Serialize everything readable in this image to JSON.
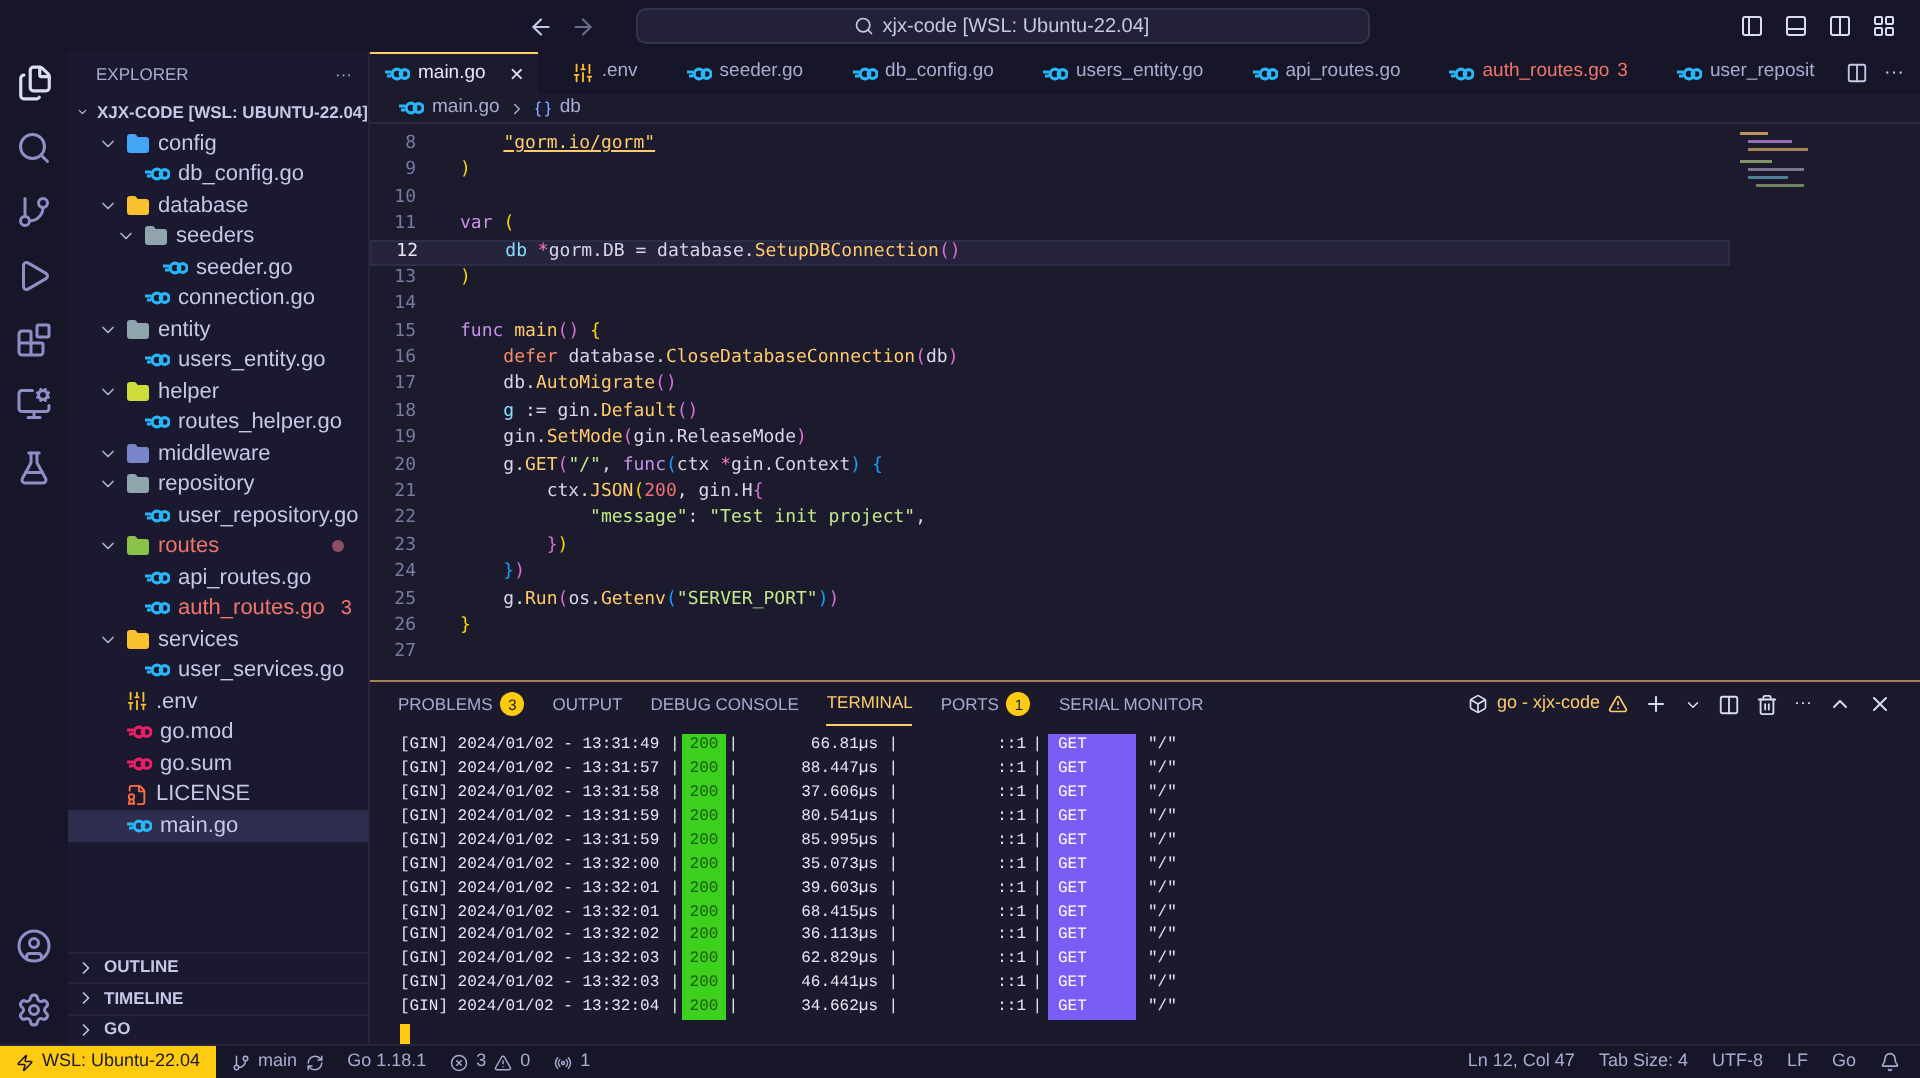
{
  "title_bar": {
    "search": "xjx-code [WSL: Ubuntu-22.04]"
  },
  "sidebar": {
    "title": "EXPLORER",
    "more": "···",
    "root": {
      "name": "XJX-CODE [WSL: UBUNTU-22.04]",
      "expanded": true
    },
    "tree": [
      {
        "name": "config",
        "kind": "folder",
        "color": "#42a5f5",
        "expanded": true,
        "selected": false,
        "error": false,
        "children": [
          {
            "name": "db_config.go",
            "kind": "go",
            "selected": false,
            "error": false
          }
        ]
      },
      {
        "name": "database",
        "kind": "folder",
        "color": "#fbc02d",
        "expanded": true,
        "selected": false,
        "error": false,
        "children": [
          {
            "name": "seeders",
            "kind": "folder",
            "color": "#90a4ae",
            "expanded": true,
            "selected": false,
            "error": false,
            "children": [
              {
                "name": "seeder.go",
                "kind": "go",
                "selected": false,
                "error": false
              }
            ]
          },
          {
            "name": "connection.go",
            "kind": "go",
            "selected": false,
            "error": false
          }
        ]
      },
      {
        "name": "entity",
        "kind": "folder",
        "color": "#90a4ae",
        "expanded": true,
        "selected": false,
        "error": false,
        "children": [
          {
            "name": "users_entity.go",
            "kind": "go",
            "selected": false,
            "error": false
          }
        ]
      },
      {
        "name": "helper",
        "kind": "folder",
        "color": "#cddc39",
        "expanded": true,
        "selected": false,
        "error": false,
        "children": [
          {
            "name": "routes_helper.go",
            "kind": "go",
            "selected": false,
            "error": false
          }
        ]
      },
      {
        "name": "middleware",
        "kind": "folder",
        "color": "#7986cb",
        "expanded": true,
        "selected": false,
        "error": false
      },
      {
        "name": "repository",
        "kind": "folder",
        "color": "#90a4ae",
        "expanded": true,
        "selected": false,
        "error": false,
        "children": [
          {
            "name": "user_repository.go",
            "kind": "go",
            "selected": false,
            "error": false
          }
        ]
      },
      {
        "name": "routes",
        "kind": "folder",
        "color": "#8bc34a",
        "expanded": true,
        "selected": false,
        "error": true,
        "children": [
          {
            "name": "api_routes.go",
            "kind": "go",
            "selected": false,
            "error": false
          },
          {
            "name": "auth_routes.go",
            "kind": "go",
            "selected": false,
            "error": true,
            "badge": "3"
          }
        ]
      },
      {
        "name": "services",
        "kind": "folder",
        "color": "#fbc02d",
        "expanded": true,
        "selected": false,
        "error": false,
        "children": [
          {
            "name": "user_services.go",
            "kind": "go",
            "selected": false,
            "error": false
          }
        ]
      },
      {
        "name": ".env",
        "kind": "env",
        "selected": false,
        "error": false
      },
      {
        "name": "go.mod",
        "kind": "gomod",
        "selected": false,
        "error": false
      },
      {
        "name": "go.sum",
        "kind": "gomod",
        "selected": false,
        "error": false
      },
      {
        "name": "LICENSE",
        "kind": "license",
        "selected": false,
        "error": false
      },
      {
        "name": "main.go",
        "kind": "go",
        "selected": true,
        "error": false
      }
    ],
    "sections": [
      {
        "title": "OUTLINE",
        "expanded": false
      },
      {
        "title": "TIMELINE",
        "expanded": false
      },
      {
        "title": "GO",
        "expanded": false
      }
    ]
  },
  "tabs": [
    {
      "label": "main.go",
      "kind": "go",
      "selected": true,
      "error": false,
      "close": "×"
    },
    {
      "label": ".env",
      "kind": "env",
      "selected": false,
      "error": false
    },
    {
      "label": "seeder.go",
      "kind": "go",
      "selected": false,
      "error": false
    },
    {
      "label": "db_config.go",
      "kind": "go",
      "selected": false,
      "error": false
    },
    {
      "label": "users_entity.go",
      "kind": "go",
      "selected": false,
      "error": false
    },
    {
      "label": "api_routes.go",
      "kind": "go",
      "selected": false,
      "error": false
    },
    {
      "label": "auth_routes.go",
      "kind": "go",
      "selected": false,
      "error": true,
      "badge": "3"
    },
    {
      "label": "user_reposit",
      "kind": "go",
      "selected": false,
      "error": false
    }
  ],
  "tab_more": "···",
  "breadcrumb": [
    "main.go",
    "db"
  ],
  "code_lines": [
    {
      "number": "8",
      "highlighted": false,
      "tokens": [
        {
          "text": "    \"gorm.io/gorm\"",
          "kind": "link"
        }
      ]
    },
    {
      "number": "9",
      "highlighted": false,
      "tokens": [
        {
          "text": ")",
          "kind": "b1"
        }
      ]
    },
    {
      "number": "10",
      "highlighted": false
    },
    {
      "number": "11",
      "highlighted": false,
      "tokens": [
        {
          "text": "var ",
          "kind": "keyword"
        },
        {
          "text": "(",
          "kind": "b1"
        }
      ]
    },
    {
      "number": "12",
      "highlighted": true,
      "tokens": [
        {
          "text": "    db",
          "kind": "variable"
        },
        {
          "text": " *",
          "kind": "op"
        },
        {
          "text": "gorm.DB = database.",
          "kind": "plain"
        },
        {
          "text": "SetupDBConnection",
          "kind": "func"
        },
        {
          "text": "()",
          "kind": "b2"
        }
      ]
    },
    {
      "number": "13",
      "highlighted": false,
      "tokens": [
        {
          "text": ")",
          "kind": "b1"
        }
      ]
    },
    {
      "number": "14",
      "highlighted": false
    },
    {
      "number": "15",
      "highlighted": false,
      "tokens": [
        {
          "text": "func ",
          "kind": "keyword"
        },
        {
          "text": "main",
          "kind": "func"
        },
        {
          "text": "()",
          "kind": "b2"
        },
        {
          "text": " {",
          "kind": "b1"
        }
      ]
    },
    {
      "number": "16",
      "highlighted": false,
      "tokens": [
        {
          "text": "    defer",
          "kind": "control"
        },
        {
          "text": " database.",
          "kind": "plain"
        },
        {
          "text": "CloseDatabaseConnection",
          "kind": "func"
        },
        {
          "text": "(",
          "kind": "b2"
        },
        {
          "text": "db",
          "kind": "plain"
        },
        {
          "text": ")",
          "kind": "b2"
        }
      ]
    },
    {
      "number": "17",
      "highlighted": false,
      "tokens": [
        {
          "text": "    db.",
          "kind": "plain"
        },
        {
          "text": "AutoMigrate",
          "kind": "func"
        },
        {
          "text": "()",
          "kind": "b2"
        }
      ]
    },
    {
      "number": "18",
      "highlighted": false,
      "tokens": [
        {
          "text": "    g",
          "kind": "variable"
        },
        {
          "text": " := gin.",
          "kind": "plain"
        },
        {
          "text": "Default",
          "kind": "func"
        },
        {
          "text": "()",
          "kind": "b2"
        }
      ]
    },
    {
      "number": "19",
      "highlighted": false,
      "tokens": [
        {
          "text": "    gin.",
          "kind": "plain"
        },
        {
          "text": "SetMode",
          "kind": "func"
        },
        {
          "text": "(",
          "kind": "b2"
        },
        {
          "text": "gin.ReleaseMode",
          "kind": "plain"
        },
        {
          "text": ")",
          "kind": "b2"
        }
      ]
    },
    {
      "number": "20",
      "highlighted": false,
      "tokens": [
        {
          "text": "    g.",
          "kind": "plain"
        },
        {
          "text": "GET",
          "kind": "func"
        },
        {
          "text": "(",
          "kind": "b2"
        },
        {
          "text": "\"/\"",
          "kind": "string"
        },
        {
          "text": ", ",
          "kind": "plain"
        },
        {
          "text": "func",
          "kind": "keyword"
        },
        {
          "text": "(",
          "kind": "b3"
        },
        {
          "text": "ctx ",
          "kind": "plain"
        },
        {
          "text": "*",
          "kind": "op"
        },
        {
          "text": "gin.Context",
          "kind": "plain"
        },
        {
          "text": ")",
          "kind": "b3"
        },
        {
          "text": " {",
          "kind": "b3"
        }
      ]
    },
    {
      "number": "21",
      "highlighted": false,
      "tokens": [
        {
          "text": "        ctx.",
          "kind": "plain"
        },
        {
          "text": "JSON",
          "kind": "func"
        },
        {
          "text": "(",
          "kind": "b1"
        },
        {
          "text": "200",
          "kind": "number"
        },
        {
          "text": ", gin.H",
          "kind": "plain"
        },
        {
          "text": "{",
          "kind": "b2"
        }
      ]
    },
    {
      "number": "22",
      "highlighted": false,
      "tokens": [
        {
          "text": "            \"message\"",
          "kind": "string"
        },
        {
          "text": ": ",
          "kind": "plain"
        },
        {
          "text": "\"Test init project\"",
          "kind": "string"
        },
        {
          "text": ",",
          "kind": "plain"
        }
      ]
    },
    {
      "number": "23",
      "highlighted": false,
      "tokens": [
        {
          "text": "        }",
          "kind": "b2"
        },
        {
          "text": ")",
          "kind": "b1"
        }
      ]
    },
    {
      "number": "24",
      "highlighted": false,
      "tokens": [
        {
          "text": "    }",
          "kind": "b3"
        },
        {
          "text": ")",
          "kind": "b2"
        }
      ]
    },
    {
      "number": "25",
      "highlighted": false,
      "tokens": [
        {
          "text": "    g.",
          "kind": "plain"
        },
        {
          "text": "Run",
          "kind": "func"
        },
        {
          "text": "(",
          "kind": "b2"
        },
        {
          "text": "os.",
          "kind": "plain"
        },
        {
          "text": "Getenv",
          "kind": "func"
        },
        {
          "text": "(",
          "kind": "b3"
        },
        {
          "text": "\"SERVER_PORT\"",
          "kind": "string"
        },
        {
          "text": ")",
          "kind": "b3"
        },
        {
          "text": ")",
          "kind": "b2"
        }
      ]
    },
    {
      "number": "26",
      "highlighted": false,
      "tokens": [
        {
          "text": "}",
          "kind": "b1"
        }
      ]
    },
    {
      "number": "27",
      "highlighted": false
    }
  ],
  "panel": {
    "tabs": [
      {
        "label": "PROBLEMS",
        "selected": false,
        "badge": "3"
      },
      {
        "label": "OUTPUT",
        "selected": false
      },
      {
        "label": "DEBUG CONSOLE",
        "selected": false
      },
      {
        "label": "TERMINAL",
        "selected": true
      },
      {
        "label": "PORTS",
        "selected": false,
        "badge": "1"
      },
      {
        "label": "SERIAL MONITOR",
        "selected": false
      }
    ],
    "terminal_name": "go - xjx-code",
    "more": "···",
    "separator": "|",
    "terminal_rows": [
      {
        "prefix": "[GIN] 2024/01/02 - 13:31:49",
        "status": "200",
        "latency": "66.81µs",
        "ip": "::1",
        "method": "GET",
        "path": "\"/\""
      },
      {
        "prefix": "[GIN] 2024/01/02 - 13:31:57",
        "status": "200",
        "latency": "88.447µs",
        "ip": "::1",
        "method": "GET",
        "path": "\"/\""
      },
      {
        "prefix": "[GIN] 2024/01/02 - 13:31:58",
        "status": "200",
        "latency": "37.606µs",
        "ip": "::1",
        "method": "GET",
        "path": "\"/\""
      },
      {
        "prefix": "[GIN] 2024/01/02 - 13:31:59",
        "status": "200",
        "latency": "80.541µs",
        "ip": "::1",
        "method": "GET",
        "path": "\"/\""
      },
      {
        "prefix": "[GIN] 2024/01/02 - 13:31:59",
        "status": "200",
        "latency": "85.995µs",
        "ip": "::1",
        "method": "GET",
        "path": "\"/\""
      },
      {
        "prefix": "[GIN] 2024/01/02 - 13:32:00",
        "status": "200",
        "latency": "35.073µs",
        "ip": "::1",
        "method": "GET",
        "path": "\"/\""
      },
      {
        "prefix": "[GIN] 2024/01/02 - 13:32:01",
        "status": "200",
        "latency": "39.603µs",
        "ip": "::1",
        "method": "GET",
        "path": "\"/\""
      },
      {
        "prefix": "[GIN] 2024/01/02 - 13:32:01",
        "status": "200",
        "latency": "68.415µs",
        "ip": "::1",
        "method": "GET",
        "path": "\"/\""
      },
      {
        "prefix": "[GIN] 2024/01/02 - 13:32:02",
        "status": "200",
        "latency": "36.113µs",
        "ip": "::1",
        "method": "GET",
        "path": "\"/\""
      },
      {
        "prefix": "[GIN] 2024/01/02 - 13:32:03",
        "status": "200",
        "latency": "62.829µs",
        "ip": "::1",
        "method": "GET",
        "path": "\"/\""
      },
      {
        "prefix": "[GIN] 2024/01/02 - 13:32:03",
        "status": "200",
        "latency": "46.441µs",
        "ip": "::1",
        "method": "GET",
        "path": "\"/\""
      },
      {
        "prefix": "[GIN] 2024/01/02 - 13:32:04",
        "status": "200",
        "latency": "34.662µs",
        "ip": "::1",
        "method": "GET",
        "path": "\"/\""
      }
    ]
  },
  "status_bar": {
    "remote": "WSL: Ubuntu-22.04",
    "branch": "main",
    "go_version": "Go 1.18.1",
    "errors": "3",
    "warnings": "0",
    "ports": "1",
    "right": [
      "Ln 12, Col 47",
      "Tab Size: 4",
      "UTF-8",
      "LF",
      "Go"
    ]
  }
}
